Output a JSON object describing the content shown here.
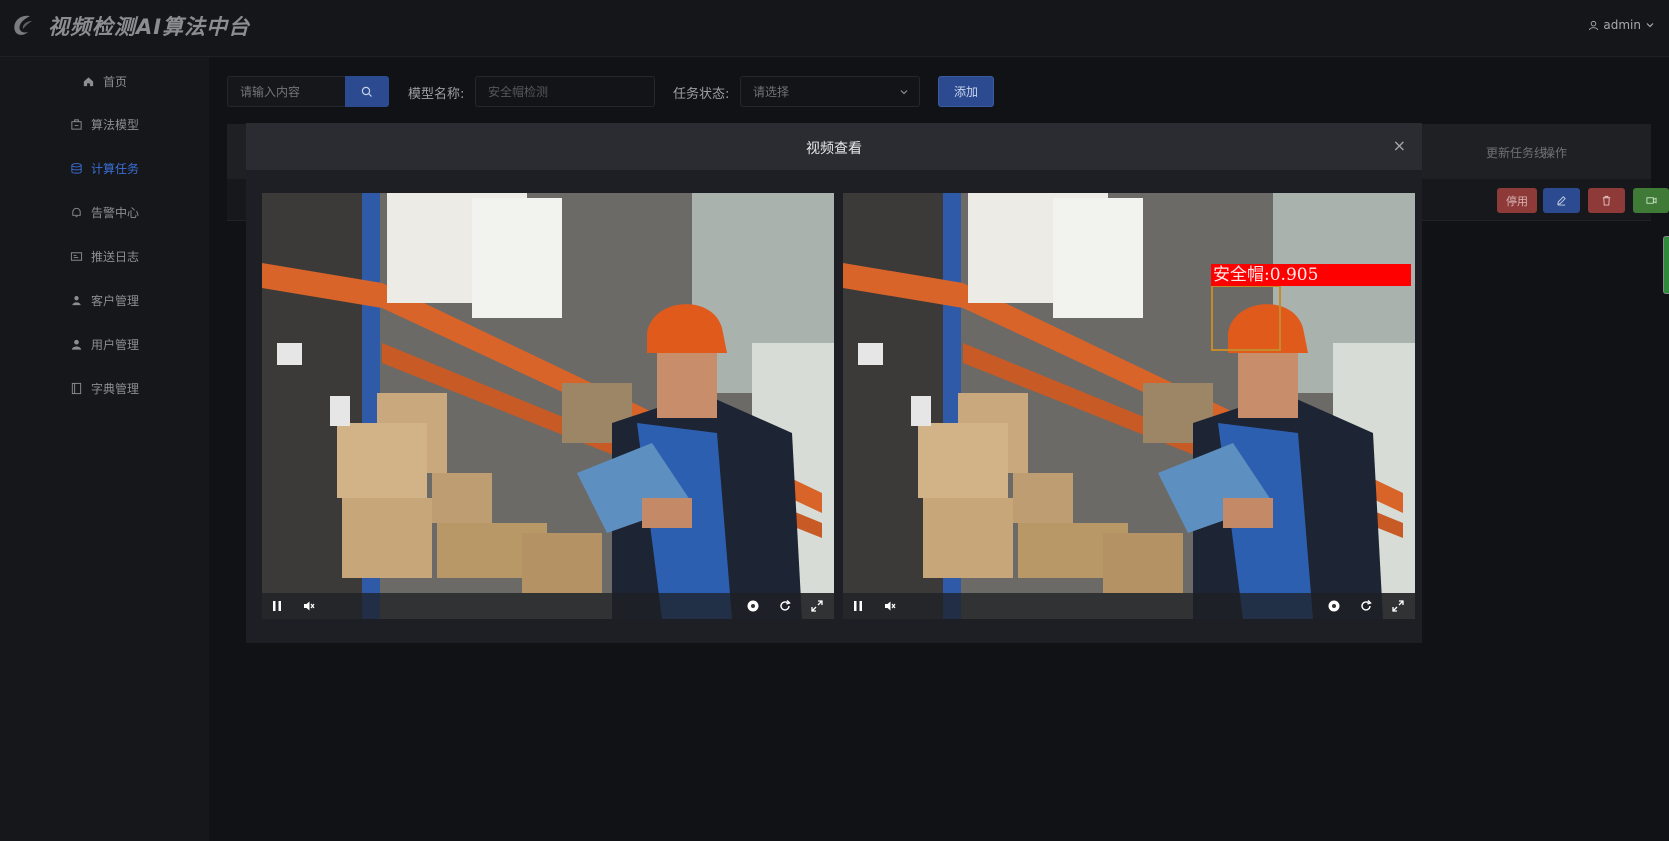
{
  "header": {
    "title": "视频检测AI算法中台",
    "user": "admin"
  },
  "sidebar": {
    "items": [
      {
        "label": "首页",
        "icon": "home-icon"
      },
      {
        "label": "算法模型",
        "icon": "package-icon"
      },
      {
        "label": "计算任务",
        "icon": "database-icon",
        "active": true
      },
      {
        "label": "告警中心",
        "icon": "bell-icon"
      },
      {
        "label": "推送日志",
        "icon": "card-icon"
      },
      {
        "label": "客户管理",
        "icon": "person-icon"
      },
      {
        "label": "用户管理",
        "icon": "user-icon"
      },
      {
        "label": "字典管理",
        "icon": "book-icon"
      }
    ]
  },
  "toolbar": {
    "search_placeholder": "请输入内容",
    "model_label": "模型名称:",
    "model_value": "安全帽检测",
    "status_label": "任务状态:",
    "status_placeholder": "请选择",
    "add_label": "添加"
  },
  "table": {
    "headers": [
      "更新任务线",
      "操作"
    ],
    "row_actions": {
      "disable_label": "停用"
    }
  },
  "modal": {
    "title": "视频查看",
    "close": "×",
    "detection_label": "安全帽:0.905"
  },
  "colors": {
    "accent": "#3b6fd6",
    "danger": "#b8403f",
    "success": "#3f8a3a",
    "detection": "#ff0000"
  }
}
